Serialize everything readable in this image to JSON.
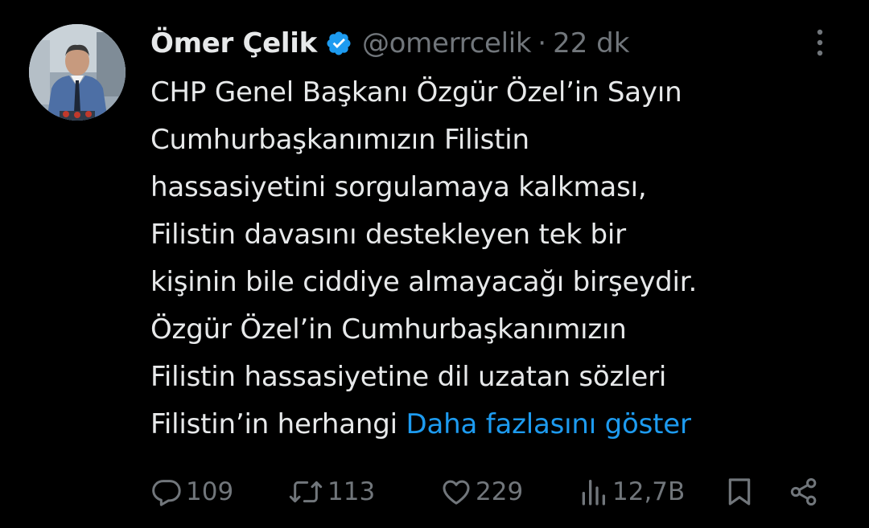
{
  "author": {
    "display_name": "Ömer Çelik",
    "handle": "@omerrcelik",
    "separator": "·",
    "time_ago": "22 dk"
  },
  "tweet": {
    "lines": [
      "CHP Genel Başkanı Özgür Özel’in Sayın",
      "Cumhurbaşkanımızın Filistin",
      "hassasiyetini sorgulamaya kalkması,",
      "Filistin davasını destekleyen tek bir",
      "kişinin bile ciddiye almayacağı birşeydir.",
      "Özgür Özel’in Cumhurbaşkanımızın",
      "Filistin hassasiyetine dil uzatan sözleri"
    ],
    "last_line_prefix": "Filistin’in herhangi ",
    "show_more": "Daha fazlasını göster"
  },
  "actions": {
    "replies": "109",
    "retweets": "113",
    "likes": "229",
    "views": "12,7B"
  },
  "icons": {
    "verified": "verified-badge-icon",
    "more": "more-vertical-icon",
    "reply": "reply-icon",
    "retweet": "retweet-icon",
    "like": "heart-icon",
    "views": "views-icon",
    "bookmark": "bookmark-icon",
    "share": "share-icon"
  },
  "colors": {
    "background": "#000000",
    "text": "#e7e9ea",
    "muted": "#71767b",
    "accent": "#1d9bf0"
  }
}
